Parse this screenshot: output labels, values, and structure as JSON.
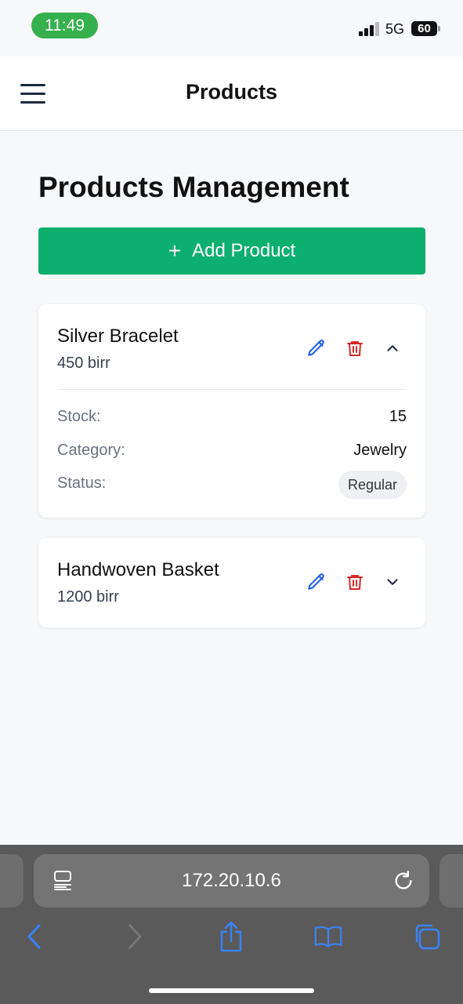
{
  "status_bar": {
    "time": "11:49",
    "network": "5G",
    "battery": "60"
  },
  "header": {
    "title": "Products",
    "menu_icon": "hamburger-menu-icon"
  },
  "main": {
    "title": "Products Management",
    "add_button": {
      "icon": "+",
      "label": "Add Product"
    },
    "products": [
      {
        "name": "Silver Bracelet",
        "price": "450 birr",
        "expanded": true,
        "details": {
          "stock_label": "Stock:",
          "stock": "15",
          "category_label": "Category:",
          "category": "Jewelry",
          "status_label": "Status:",
          "status": "Regular"
        }
      },
      {
        "name": "Handwoven Basket",
        "price": "1200 birr",
        "expanded": false
      }
    ]
  },
  "browser": {
    "url": "172.20.10.6"
  },
  "colors": {
    "accent_green": "#0daf6e",
    "edit_blue": "#2563eb",
    "delete_red": "#dc2626",
    "time_pill": "#35b04d"
  }
}
